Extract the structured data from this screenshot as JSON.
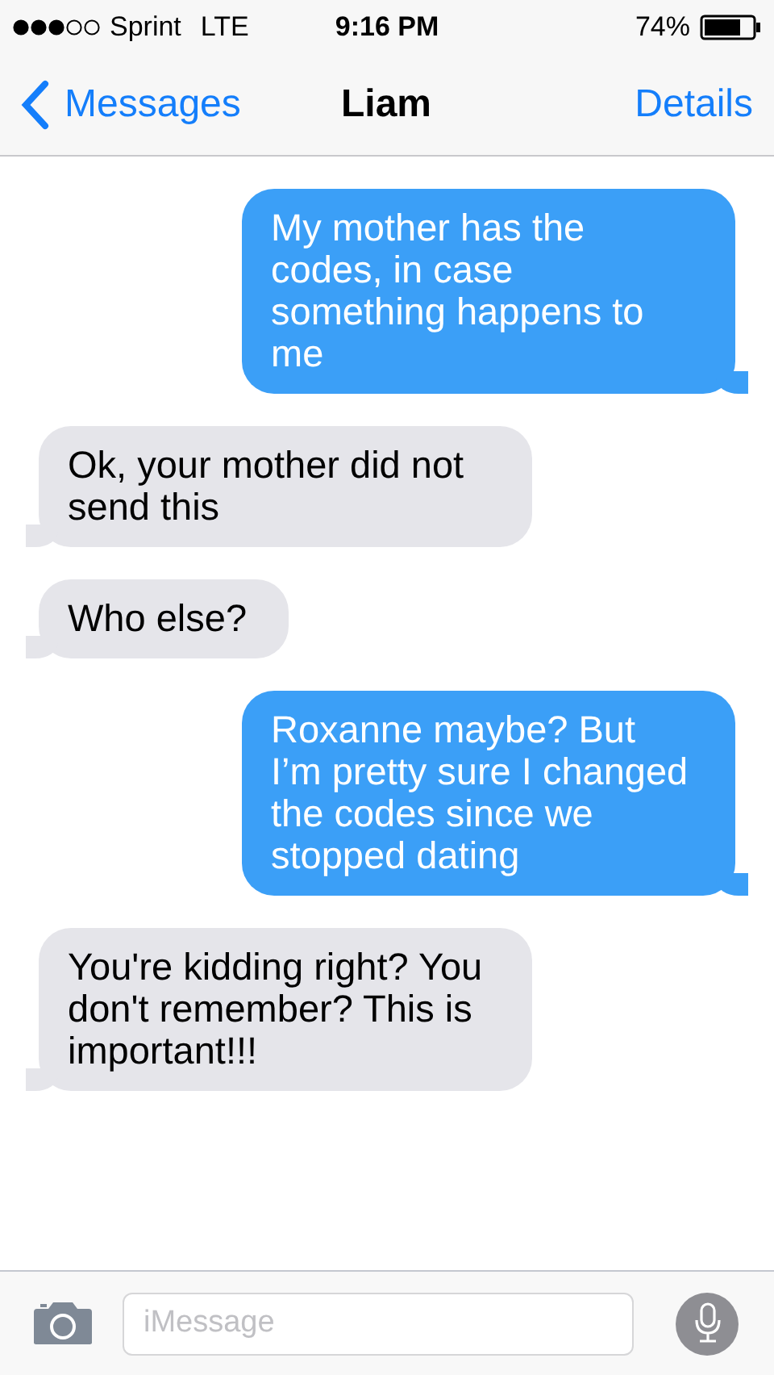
{
  "status_bar": {
    "carrier": "Sprint",
    "network": "LTE",
    "time": "9:16 PM",
    "battery": "74%"
  },
  "nav_bar": {
    "back": "Messages",
    "title": "Liam",
    "action": "Details"
  },
  "messages": [
    {
      "kind": "sent",
      "text": "My mother has the codes, in case something happens to me"
    },
    {
      "kind": "received",
      "text": "Ok, your mother did not send this"
    },
    {
      "kind": "received",
      "text": "Who else?"
    },
    {
      "kind": "sent",
      "text": "Roxanne maybe? But I’m pretty sure I changed the codes since we stopped dating"
    },
    {
      "kind": "received",
      "text": "You're kidding right? You don't remember? This is important!!!"
    }
  ],
  "input_bar": {
    "placeholder": "iMessage"
  }
}
